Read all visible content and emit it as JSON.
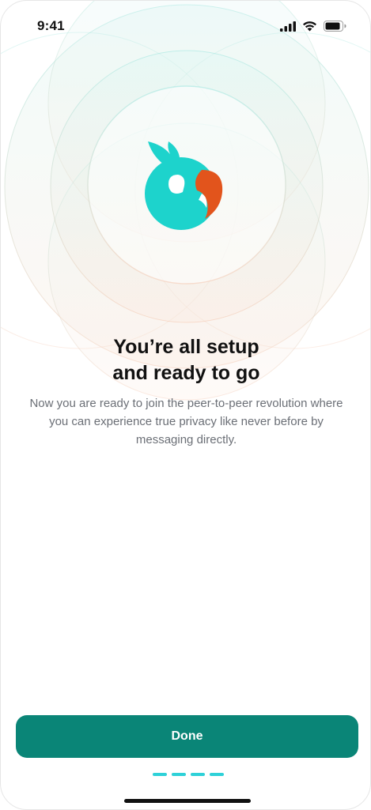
{
  "status_bar": {
    "time": "9:41"
  },
  "onboarding": {
    "title": "You’re all setup\nand ready to go",
    "description": "Now you are ready to join the peer-to-peer revolution where you can experience true privacy like never before by messaging directly.",
    "done_label": "Done",
    "page_count": 4,
    "current_page": 4
  },
  "colors": {
    "accent": "#0a8577",
    "logo_teal": "#1dd3cc",
    "logo_orange": "#e2541c",
    "indicator": "#2ed1d8",
    "ring_teal": "#8fe3dc",
    "ring_peach": "#f3c9b4"
  },
  "icons": [
    "signal-icon",
    "wifi-icon",
    "battery-icon",
    "parrot-logo"
  ]
}
